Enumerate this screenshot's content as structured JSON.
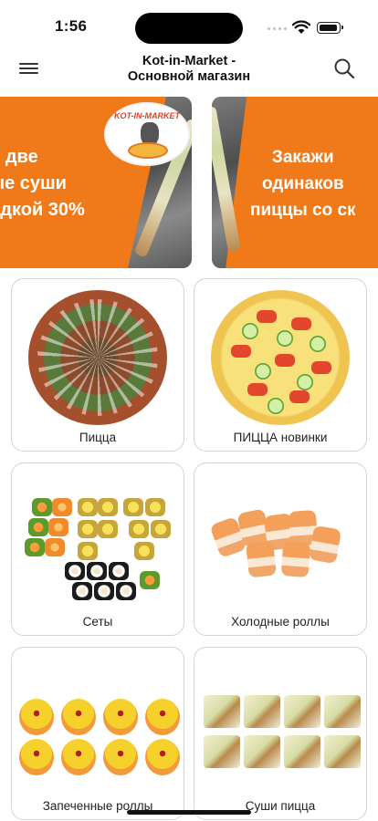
{
  "status_bar": {
    "time": "1:56"
  },
  "nav": {
    "title_line1": "Kot-in-Market -",
    "title_line2": "Основной магазин",
    "menu_icon": "hamburger-icon",
    "search_icon": "search-icon"
  },
  "banners": [
    {
      "lines": [
        "и две",
        "ые суши",
        "идкой 30%"
      ],
      "logo_text": "KOT-IN-MARKET"
    },
    {
      "lines": [
        "Закажи",
        "одинаков",
        "пиццы со ск"
      ]
    }
  ],
  "categories": [
    {
      "label": "Пицца"
    },
    {
      "label": "ПИЦЦА новинки"
    },
    {
      "label": "Сеты"
    },
    {
      "label": "Холодные роллы"
    },
    {
      "label": "Запеченные роллы"
    },
    {
      "label": "Суши пицца"
    }
  ],
  "colors": {
    "banner_orange": "#f07a1a",
    "card_border": "#d4d4d4"
  }
}
